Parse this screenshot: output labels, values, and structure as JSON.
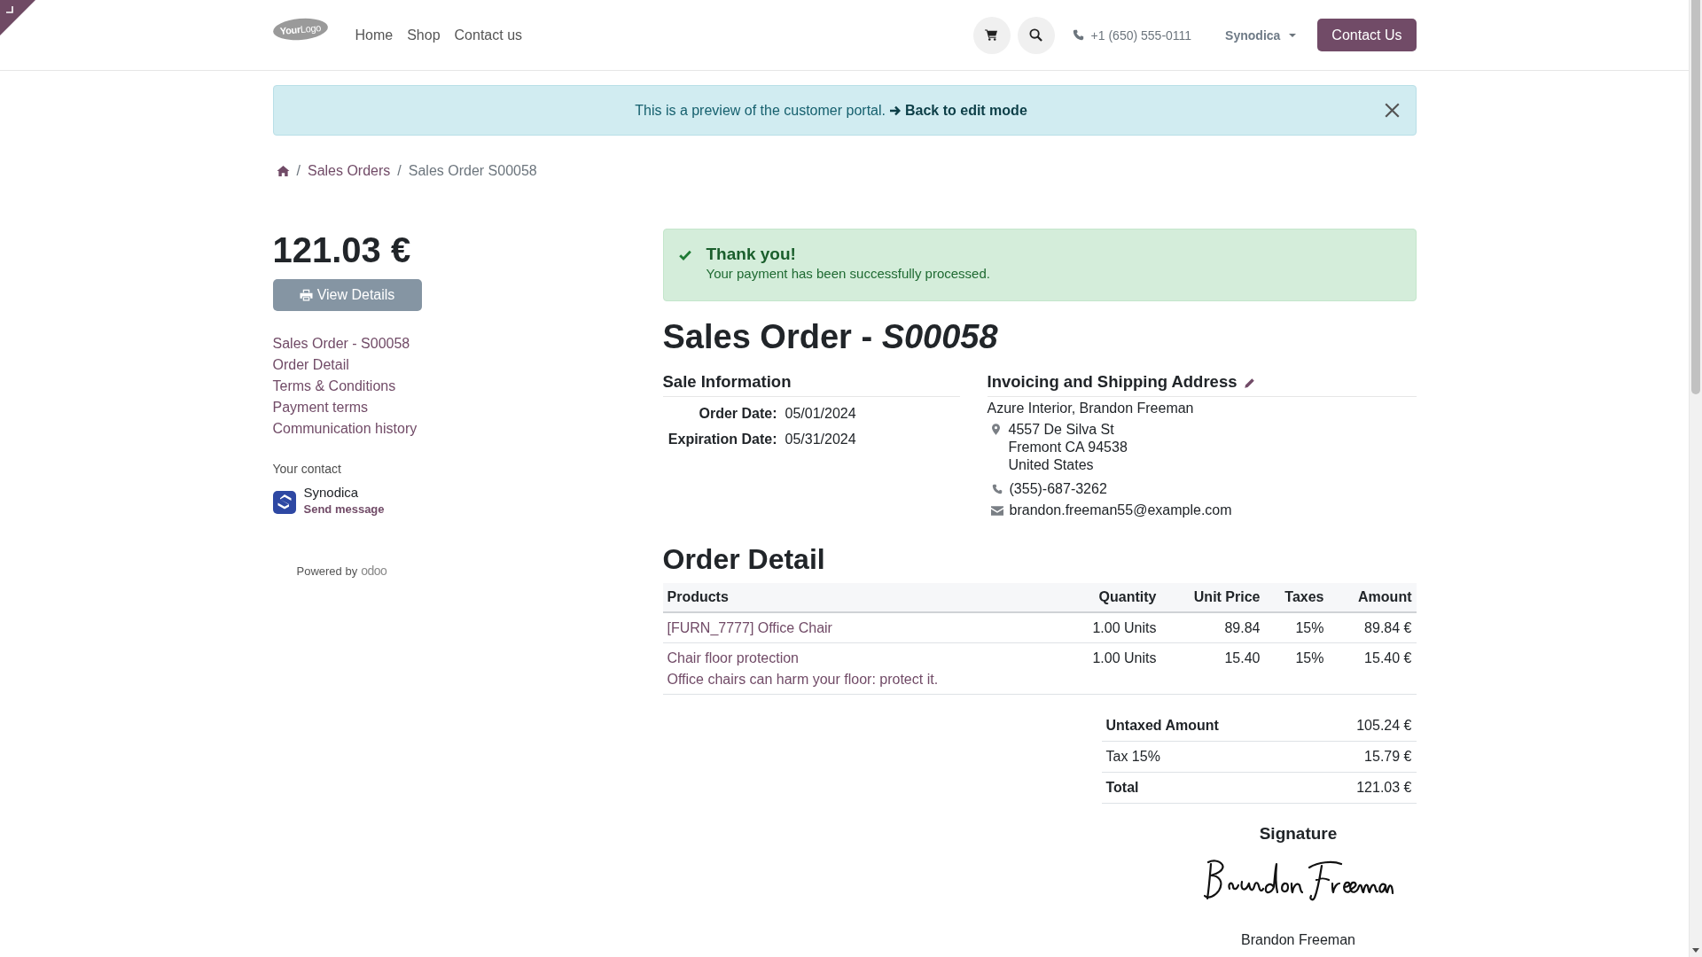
{
  "top_bar": {
    "logo": "**Your**Logo",
    "menu": [
      "Home",
      "Shop",
      "Contact us"
    ],
    "phone": "+1 (650) 555-0111",
    "user_menu": "Synodica",
    "cta_button": "Contact Us"
  },
  "preview_alert": {
    "text": "This is a preview of the customer portal.",
    "link": "Back to edit mode"
  },
  "breadcrumb": {
    "separator": "/",
    "items": [
      {
        "label": "Sales Orders",
        "current": false
      },
      {
        "label": "Sales Order S00058",
        "current": true
      }
    ]
  },
  "sidebar": {
    "amount": "121.03 €",
    "view_button": "View Details",
    "links": [
      "Sales Order - S00058",
      "Order Detail",
      "Terms & Conditions",
      "Payment terms",
      "Communication history"
    ],
    "contact": {
      "heading": "Your contact",
      "name": "Synodica",
      "action": "Send message"
    },
    "powered_by": {
      "text": "Powered by",
      "brand": "odoo"
    }
  },
  "success_alert": {
    "title": "Thank you!",
    "message": "Your payment has been successfully processed."
  },
  "title": "Sales Order - *S00058*",
  "sale_information": {
    "heading": "Sale Information",
    "fields": [
      {
        "label": "Order Date:",
        "value": "05/01/2024"
      },
      {
        "label": "Expiration Date:",
        "value": "05/31/2024"
      }
    ]
  },
  "address": {
    "heading": "Invoicing and Shipping Address",
    "name": "Azure Interior, Brandon Freeman",
    "street_lines": [
      "4557 De Silva St",
      "Fremont CA 94538",
      "United States"
    ],
    "phone": "(355)-687-3262",
    "email": "brandon.freeman55@example.com"
  },
  "order_detail": {
    "heading": "Order Detail",
    "columns": [
      "Products",
      "Quantity",
      "Unit Price",
      "Taxes",
      "Amount"
    ],
    "rows": [
      {
        "product": "[FURN_7777] Office Chair",
        "quantity": "1.00 Units",
        "unit_price": "89.84",
        "taxes": "15%",
        "amount": "89.84 €"
      },
      {
        "product": "Chair floor protection",
        "description": "Office chairs can harm your floor: protect it.",
        "quantity": "1.00 Units",
        "unit_price": "15.40",
        "taxes": "15%",
        "amount": "15.40 €"
      }
    ],
    "totals": [
      {
        "kind": "subtotal",
        "label": "Untaxed Amount",
        "value": "105.24 €"
      },
      {
        "kind": "tax",
        "label": "Tax 15%",
        "value": "15.79 €"
      },
      {
        "kind": "total",
        "label": "Total",
        "value": "121.03 €"
      }
    ]
  },
  "signature": {
    "heading": "Signature",
    "name": "Brandon Freeman"
  }
}
